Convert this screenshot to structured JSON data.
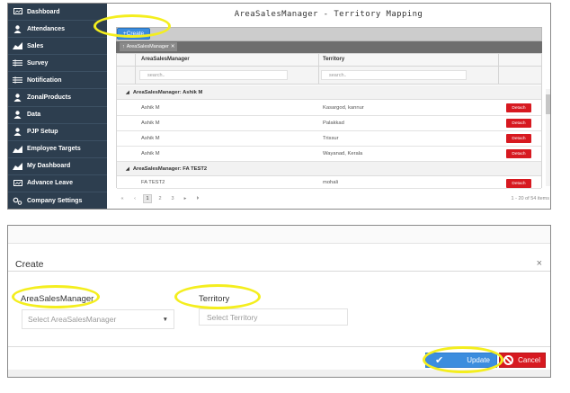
{
  "sidebar": {
    "items": [
      {
        "label": "Dashboard",
        "icon": "monitor-icon"
      },
      {
        "label": "Attendances",
        "icon": "user-icon"
      },
      {
        "label": "Sales",
        "icon": "chart-icon"
      },
      {
        "label": "Survey",
        "icon": "list-icon"
      },
      {
        "label": "Notification",
        "icon": "list-icon"
      },
      {
        "label": "ZonalProducts",
        "icon": "user-icon"
      },
      {
        "label": "Data",
        "icon": "user-icon"
      },
      {
        "label": "PJP Setup",
        "icon": "user-icon"
      },
      {
        "label": "Employee Targets",
        "icon": "chart-icon"
      },
      {
        "label": "My Dashboard",
        "icon": "chart-icon"
      },
      {
        "label": "Advance Leave",
        "icon": "monitor-icon"
      },
      {
        "label": "Company Settings",
        "icon": "gear-icon"
      }
    ]
  },
  "main": {
    "title": "AreaSalesManager - Territory Mapping",
    "create_label": "+Create",
    "group_chip": "AreaSalesManager",
    "columns": [
      "AreaSalesManager",
      "Territory"
    ],
    "filter_placeholder": "search..",
    "groups": [
      {
        "label": "AreaSalesManager: Ashik M",
        "rows": [
          {
            "asm": "Ashik M",
            "territory": "Kasargod, kannur"
          },
          {
            "asm": "Ashik M",
            "territory": "Palakkad"
          },
          {
            "asm": "Ashik M",
            "territory": "Trissur"
          },
          {
            "asm": "Ashik M",
            "territory": "Wayanad, Kerala"
          }
        ]
      },
      {
        "label": "AreaSalesManager: FA TEST2",
        "rows": [
          {
            "asm": "FA TEST2",
            "territory": "mohali"
          }
        ]
      }
    ],
    "detach_label": "Detach",
    "pager": {
      "pages": [
        "1",
        "2",
        "3"
      ],
      "current": "1",
      "info": "1 - 20 of 54 items"
    }
  },
  "modal": {
    "title": "Create",
    "close": "×",
    "asm_label": "AreaSalesManager",
    "asm_placeholder": "Select AreaSalesManager",
    "territory_label": "Territory",
    "territory_placeholder": "Select Territory",
    "update_label": "Update",
    "cancel_label": "Cancel"
  },
  "colors": {
    "sidebar": "#2d3e4f",
    "primary": "#3c8dde",
    "danger": "#d71920",
    "highlight": "#f4ee1e"
  }
}
